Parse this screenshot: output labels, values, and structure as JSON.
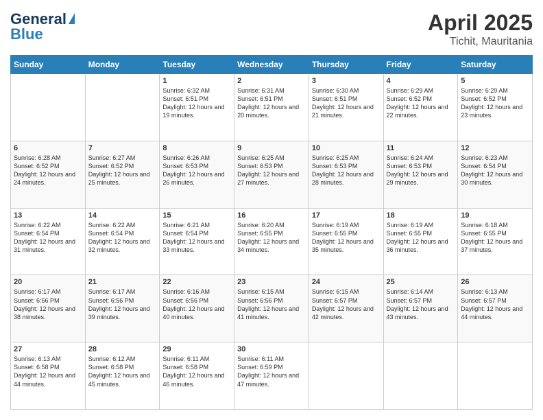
{
  "logo": {
    "line1": "General",
    "line2": "Blue"
  },
  "title": "April 2025",
  "subtitle": "Tichit, Mauritania",
  "days_of_week": [
    "Sunday",
    "Monday",
    "Tuesday",
    "Wednesday",
    "Thursday",
    "Friday",
    "Saturday"
  ],
  "weeks": [
    [
      {
        "day": "",
        "sunrise": "",
        "sunset": "",
        "daylight": ""
      },
      {
        "day": "",
        "sunrise": "",
        "sunset": "",
        "daylight": ""
      },
      {
        "day": "1",
        "sunrise": "Sunrise: 6:32 AM",
        "sunset": "Sunset: 6:51 PM",
        "daylight": "Daylight: 12 hours and 19 minutes."
      },
      {
        "day": "2",
        "sunrise": "Sunrise: 6:31 AM",
        "sunset": "Sunset: 6:51 PM",
        "daylight": "Daylight: 12 hours and 20 minutes."
      },
      {
        "day": "3",
        "sunrise": "Sunrise: 6:30 AM",
        "sunset": "Sunset: 6:51 PM",
        "daylight": "Daylight: 12 hours and 21 minutes."
      },
      {
        "day": "4",
        "sunrise": "Sunrise: 6:29 AM",
        "sunset": "Sunset: 6:52 PM",
        "daylight": "Daylight: 12 hours and 22 minutes."
      },
      {
        "day": "5",
        "sunrise": "Sunrise: 6:29 AM",
        "sunset": "Sunset: 6:52 PM",
        "daylight": "Daylight: 12 hours and 23 minutes."
      }
    ],
    [
      {
        "day": "6",
        "sunrise": "Sunrise: 6:28 AM",
        "sunset": "Sunset: 6:52 PM",
        "daylight": "Daylight: 12 hours and 24 minutes."
      },
      {
        "day": "7",
        "sunrise": "Sunrise: 6:27 AM",
        "sunset": "Sunset: 6:52 PM",
        "daylight": "Daylight: 12 hours and 25 minutes."
      },
      {
        "day": "8",
        "sunrise": "Sunrise: 6:26 AM",
        "sunset": "Sunset: 6:53 PM",
        "daylight": "Daylight: 12 hours and 26 minutes."
      },
      {
        "day": "9",
        "sunrise": "Sunrise: 6:25 AM",
        "sunset": "Sunset: 6:53 PM",
        "daylight": "Daylight: 12 hours and 27 minutes."
      },
      {
        "day": "10",
        "sunrise": "Sunrise: 6:25 AM",
        "sunset": "Sunset: 6:53 PM",
        "daylight": "Daylight: 12 hours and 28 minutes."
      },
      {
        "day": "11",
        "sunrise": "Sunrise: 6:24 AM",
        "sunset": "Sunset: 6:53 PM",
        "daylight": "Daylight: 12 hours and 29 minutes."
      },
      {
        "day": "12",
        "sunrise": "Sunrise: 6:23 AM",
        "sunset": "Sunset: 6:54 PM",
        "daylight": "Daylight: 12 hours and 30 minutes."
      }
    ],
    [
      {
        "day": "13",
        "sunrise": "Sunrise: 6:22 AM",
        "sunset": "Sunset: 6:54 PM",
        "daylight": "Daylight: 12 hours and 31 minutes."
      },
      {
        "day": "14",
        "sunrise": "Sunrise: 6:22 AM",
        "sunset": "Sunset: 6:54 PM",
        "daylight": "Daylight: 12 hours and 32 minutes."
      },
      {
        "day": "15",
        "sunrise": "Sunrise: 6:21 AM",
        "sunset": "Sunset: 6:54 PM",
        "daylight": "Daylight: 12 hours and 33 minutes."
      },
      {
        "day": "16",
        "sunrise": "Sunrise: 6:20 AM",
        "sunset": "Sunset: 6:55 PM",
        "daylight": "Daylight: 12 hours and 34 minutes."
      },
      {
        "day": "17",
        "sunrise": "Sunrise: 6:19 AM",
        "sunset": "Sunset: 6:55 PM",
        "daylight": "Daylight: 12 hours and 35 minutes."
      },
      {
        "day": "18",
        "sunrise": "Sunrise: 6:19 AM",
        "sunset": "Sunset: 6:55 PM",
        "daylight": "Daylight: 12 hours and 36 minutes."
      },
      {
        "day": "19",
        "sunrise": "Sunrise: 6:18 AM",
        "sunset": "Sunset: 6:55 PM",
        "daylight": "Daylight: 12 hours and 37 minutes."
      }
    ],
    [
      {
        "day": "20",
        "sunrise": "Sunrise: 6:17 AM",
        "sunset": "Sunset: 6:56 PM",
        "daylight": "Daylight: 12 hours and 38 minutes."
      },
      {
        "day": "21",
        "sunrise": "Sunrise: 6:17 AM",
        "sunset": "Sunset: 6:56 PM",
        "daylight": "Daylight: 12 hours and 39 minutes."
      },
      {
        "day": "22",
        "sunrise": "Sunrise: 6:16 AM",
        "sunset": "Sunset: 6:56 PM",
        "daylight": "Daylight: 12 hours and 40 minutes."
      },
      {
        "day": "23",
        "sunrise": "Sunrise: 6:15 AM",
        "sunset": "Sunset: 6:56 PM",
        "daylight": "Daylight: 12 hours and 41 minutes."
      },
      {
        "day": "24",
        "sunrise": "Sunrise: 6:15 AM",
        "sunset": "Sunset: 6:57 PM",
        "daylight": "Daylight: 12 hours and 42 minutes."
      },
      {
        "day": "25",
        "sunrise": "Sunrise: 6:14 AM",
        "sunset": "Sunset: 6:57 PM",
        "daylight": "Daylight: 12 hours and 43 minutes."
      },
      {
        "day": "26",
        "sunrise": "Sunrise: 6:13 AM",
        "sunset": "Sunset: 6:57 PM",
        "daylight": "Daylight: 12 hours and 44 minutes."
      }
    ],
    [
      {
        "day": "27",
        "sunrise": "Sunrise: 6:13 AM",
        "sunset": "Sunset: 6:58 PM",
        "daylight": "Daylight: 12 hours and 44 minutes."
      },
      {
        "day": "28",
        "sunrise": "Sunrise: 6:12 AM",
        "sunset": "Sunset: 6:58 PM",
        "daylight": "Daylight: 12 hours and 45 minutes."
      },
      {
        "day": "29",
        "sunrise": "Sunrise: 6:11 AM",
        "sunset": "Sunset: 6:58 PM",
        "daylight": "Daylight: 12 hours and 46 minutes."
      },
      {
        "day": "30",
        "sunrise": "Sunrise: 6:11 AM",
        "sunset": "Sunset: 6:59 PM",
        "daylight": "Daylight: 12 hours and 47 minutes."
      },
      {
        "day": "",
        "sunrise": "",
        "sunset": "",
        "daylight": ""
      },
      {
        "day": "",
        "sunrise": "",
        "sunset": "",
        "daylight": ""
      },
      {
        "day": "",
        "sunrise": "",
        "sunset": "",
        "daylight": ""
      }
    ]
  ]
}
